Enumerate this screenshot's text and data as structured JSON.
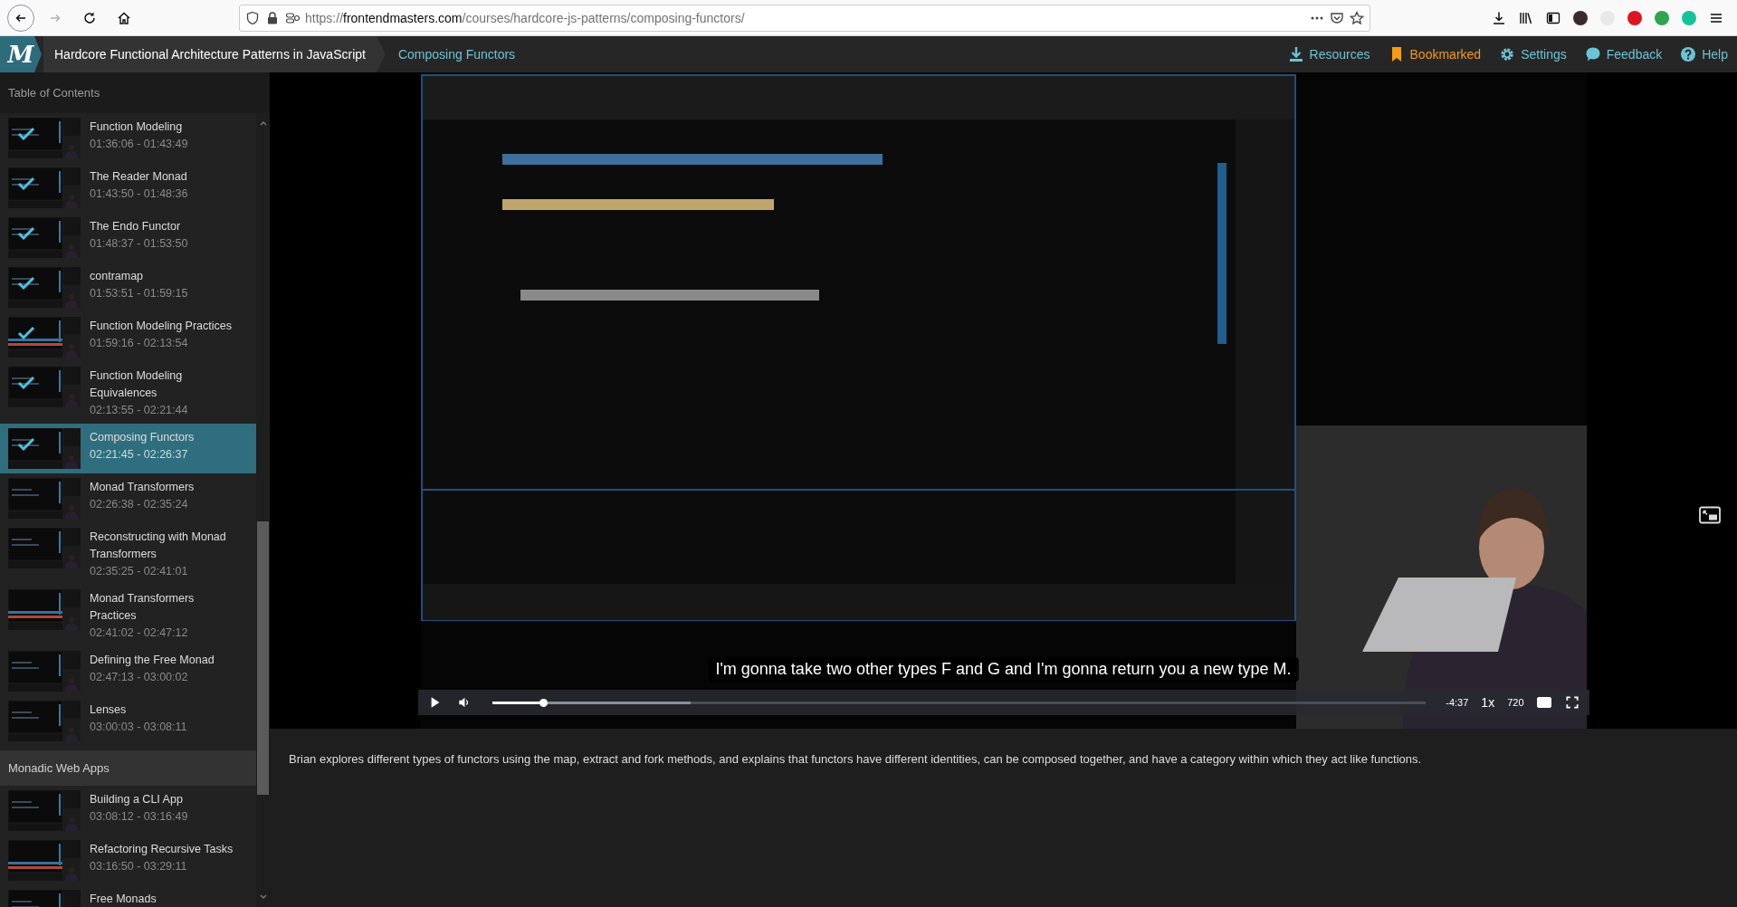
{
  "browser": {
    "url": {
      "scheme": "https://",
      "host": "frontendmasters.com",
      "path": "/courses/hardcore-js-patterns/composing-functors/"
    }
  },
  "header": {
    "logo": "M",
    "course_title": "Hardcore Functional Architecture Patterns in JavaScript",
    "lesson_title": "Composing Functors",
    "links": [
      {
        "kind": "resources",
        "label": "Resources",
        "active": false
      },
      {
        "kind": "bookmark",
        "label": "Bookmarked",
        "active": true
      },
      {
        "kind": "settings",
        "label": "Settings",
        "active": false
      },
      {
        "kind": "feedback",
        "label": "Feedback",
        "active": false
      },
      {
        "kind": "help",
        "label": "Help",
        "active": false
      }
    ]
  },
  "sidebar": {
    "title": "Table of Contents",
    "entries": [
      {
        "kind": "lesson",
        "title": "Function Modeling",
        "time": "01:36:06 - 01:43:49",
        "watched": true,
        "selected": false
      },
      {
        "kind": "lesson",
        "title": "The Reader Monad",
        "time": "01:43:50 - 01:48:36",
        "watched": true,
        "selected": false
      },
      {
        "kind": "lesson",
        "title": "The Endo Functor",
        "time": "01:48:37 - 01:53:50",
        "watched": true,
        "selected": false
      },
      {
        "kind": "lesson",
        "title": "contramap",
        "time": "01:53:51 - 01:59:15",
        "watched": true,
        "selected": false
      },
      {
        "kind": "lesson",
        "title": "Function Modeling Practices",
        "time": "01:59:16 - 02:13:54",
        "watched": true,
        "selected": false
      },
      {
        "kind": "lesson",
        "title": "Function Modeling Equivalences",
        "time": "02:13:55 - 02:21:44",
        "watched": true,
        "selected": false
      },
      {
        "kind": "lesson",
        "title": "Composing Functors",
        "time": "02:21:45 - 02:26:37",
        "watched": true,
        "selected": true
      },
      {
        "kind": "lesson",
        "title": "Monad Transformers",
        "time": "02:26:38 - 02:35:24",
        "watched": false,
        "selected": false
      },
      {
        "kind": "lesson",
        "title": "Reconstructing with Monad Transformers",
        "time": "02:35:25 - 02:41:01",
        "watched": false,
        "selected": false
      },
      {
        "kind": "lesson",
        "title": "Monad Transformers Practices",
        "time": "02:41:02 - 02:47:12",
        "watched": false,
        "selected": false
      },
      {
        "kind": "lesson",
        "title": "Defining the Free Monad",
        "time": "02:47:13 - 03:00:02",
        "watched": false,
        "selected": false
      },
      {
        "kind": "lesson",
        "title": "Lenses",
        "time": "03:00:03 - 03:08:11",
        "watched": false,
        "selected": false
      },
      {
        "kind": "section",
        "title": "Monadic Web Apps"
      },
      {
        "kind": "lesson",
        "title": "Building a CLI App",
        "time": "03:08:12 - 03:16:49",
        "watched": false,
        "selected": false
      },
      {
        "kind": "lesson",
        "title": "Refactoring Recursive Tasks",
        "time": "03:16:50 - 03:29:11",
        "watched": false,
        "selected": false
      },
      {
        "kind": "lesson",
        "title": "Free Monads",
        "watched": false,
        "selected": false
      }
    ]
  },
  "player": {
    "subtitle": "I'm gonna take two other types F and G and I'm gonna return you a new type M.",
    "progress": {
      "level": 0.055
    },
    "buffer": {
      "level": 0.213
    },
    "remaining": "-4:37",
    "speed": "1x",
    "quality": "720",
    "captions_on": true
  },
  "description": "Brian explores different types of functors using the map, extract and fork methods, and explains that functors have different identities, can be composed together, and have a category within which they act like functions."
}
